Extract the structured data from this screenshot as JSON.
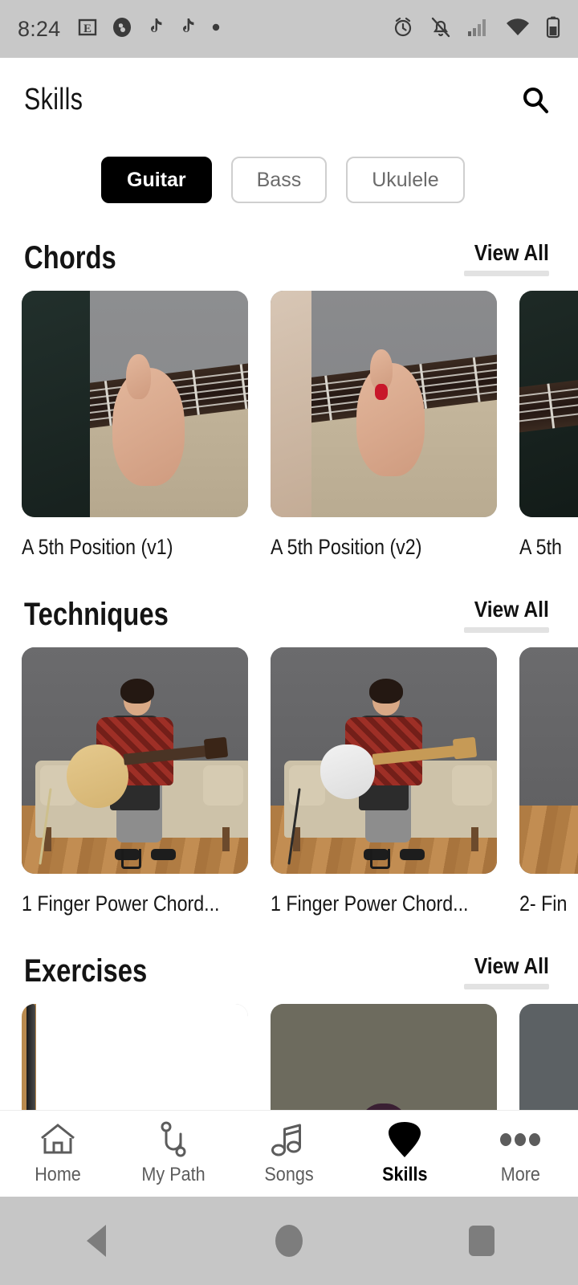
{
  "status_bar": {
    "time": "8:24",
    "left_icons": [
      "email-icon",
      "app-badge-icon",
      "tiktok-icon",
      "tiktok-icon",
      "dot-icon"
    ],
    "right_icons": [
      "alarm-icon",
      "notifications-muted-icon",
      "cellular-signal-icon",
      "wifi-icon",
      "battery-icon"
    ]
  },
  "header": {
    "title": "Skills",
    "search_icon": "search-icon"
  },
  "filters": {
    "options": [
      {
        "label": "Guitar",
        "active": true
      },
      {
        "label": "Bass",
        "active": false
      },
      {
        "label": "Ukulele",
        "active": false
      }
    ]
  },
  "sections": [
    {
      "title": "Chords",
      "view_all": "View All",
      "cards": [
        {
          "label": "A 5th Position (v1)",
          "image": "hand-on-fretboard-photo"
        },
        {
          "label": "A 5th Position (v2)",
          "image": "hand-on-fretboard-red-nails-photo"
        },
        {
          "label": "A 5th",
          "image": "guitar-fretboard-photo"
        }
      ]
    },
    {
      "title": "Techniques",
      "view_all": "View All",
      "cards": [
        {
          "label": "1 Finger Power Chord...",
          "image": "person-acoustic-guitar-couch-photo"
        },
        {
          "label": "1 Finger Power Chord...",
          "image": "person-electric-guitar-couch-photo"
        },
        {
          "label": "2- Fin",
          "image": "couch-room-photo"
        }
      ]
    },
    {
      "title": "Exercises",
      "view_all": "View All",
      "cards": [
        {
          "label": "",
          "image": "guitar-neck-closeup-photo"
        },
        {
          "label": "",
          "image": "person-purple-hair-photo"
        },
        {
          "label": "",
          "image": "gray-backdrop-photo"
        }
      ]
    }
  ],
  "bottom_nav": {
    "items": [
      {
        "label": "Home",
        "icon": "home-icon",
        "active": false
      },
      {
        "label": "My Path",
        "icon": "path-icon",
        "active": false
      },
      {
        "label": "Songs",
        "icon": "music-notes-icon",
        "active": false
      },
      {
        "label": "Skills",
        "icon": "guitar-pick-icon",
        "active": true
      },
      {
        "label": "More",
        "icon": "more-dots-icon",
        "active": false
      }
    ]
  },
  "system_nav": {
    "back": "back-button",
    "home": "home-button",
    "recents": "recents-button"
  },
  "colors": {
    "accent": "#000000",
    "status_bar_bg": "#c8c8c8",
    "system_nav_bg": "#c6c6c6",
    "chip_border": "#cfcfcf",
    "rule": "#e2e2e2"
  }
}
